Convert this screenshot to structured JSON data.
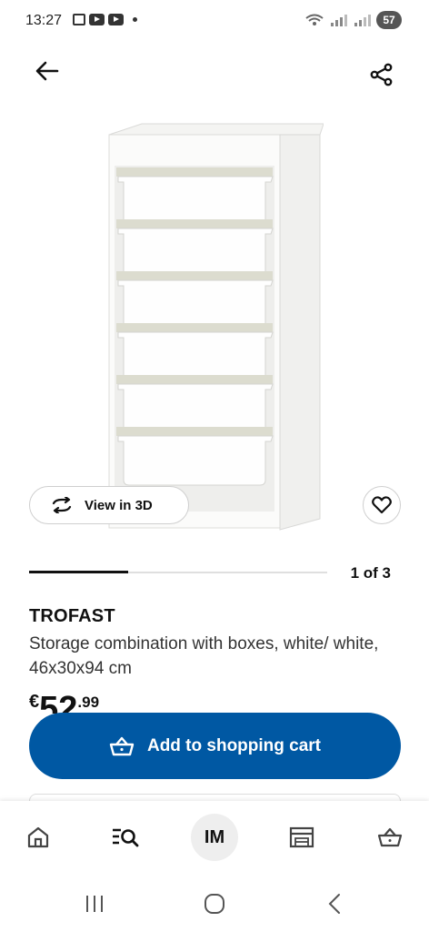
{
  "status_bar": {
    "time": "13:27",
    "battery": "57"
  },
  "product": {
    "name": "TROFAST",
    "description": "Storage combination with boxes, white/ white, 46x30x94 cm",
    "price": {
      "currency": "€",
      "integer": "52",
      "decimal": ".99"
    },
    "image_alt_icon": "storage-shelf-image"
  },
  "view3d": {
    "label": "View in 3D",
    "icon": "rotate-3d-icon"
  },
  "gallery": {
    "indicator": "1 of 3",
    "progress": 0.333
  },
  "actions": {
    "add_to_cart_label": "Add to shopping cart"
  },
  "bottom_nav": {
    "items": [
      {
        "name": "home",
        "icon": "home-icon"
      },
      {
        "name": "search",
        "icon": "search-list-icon"
      },
      {
        "name": "account",
        "label": "IM"
      },
      {
        "name": "stores",
        "icon": "store-icon"
      },
      {
        "name": "cart",
        "icon": "cart-icon"
      }
    ]
  },
  "colors": {
    "brand_blue": "#0058a3",
    "text": "#111111"
  }
}
